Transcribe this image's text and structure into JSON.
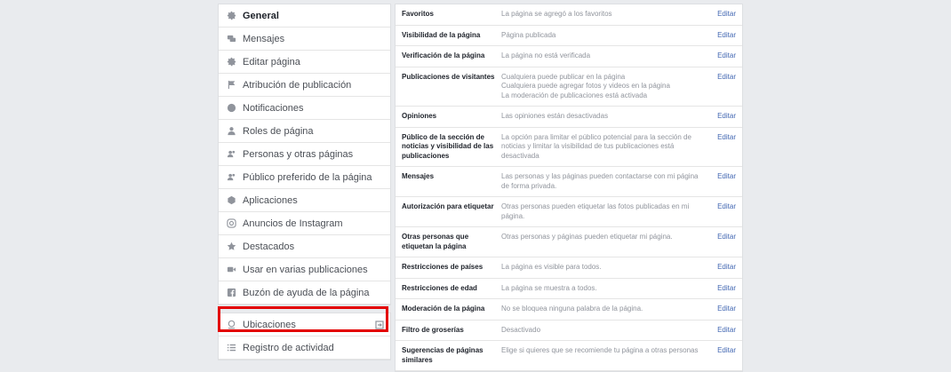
{
  "sidebar": {
    "items": [
      {
        "label": "General",
        "icon": "gear-icon",
        "active": true
      },
      {
        "label": "Mensajes",
        "icon": "messages-icon"
      },
      {
        "label": "Editar página",
        "icon": "gear-icon"
      },
      {
        "label": "Atribución de publicación",
        "icon": "flag-icon"
      },
      {
        "label": "Notificaciones",
        "icon": "globe-icon"
      },
      {
        "label": "Roles de página",
        "icon": "person-icon"
      },
      {
        "label": "Personas y otras páginas",
        "icon": "people-icon"
      },
      {
        "label": "Público preferido de la página",
        "icon": "people-icon"
      },
      {
        "label": "Aplicaciones",
        "icon": "cube-icon"
      },
      {
        "label": "Anuncios de Instagram",
        "icon": "instagram-icon"
      },
      {
        "label": "Destacados",
        "icon": "star-icon"
      },
      {
        "label": "Usar en varias publicaciones",
        "icon": "video-icon"
      },
      {
        "label": "Buzón de ayuda de la página",
        "icon": "facebook-icon"
      }
    ],
    "bottom_items": [
      {
        "label": "Ubicaciones",
        "icon": "location-icon"
      },
      {
        "label": "Registro de actividad",
        "icon": "list-icon"
      }
    ]
  },
  "settings": {
    "edit_label": "Editar",
    "rows": [
      {
        "label": "Favoritos",
        "desc": "La página se agregó a los favoritos"
      },
      {
        "label": "Visibilidad de la página",
        "desc": "Página publicada"
      },
      {
        "label": "Verificación de la página",
        "desc": "La página no está verificada"
      },
      {
        "label": "Publicaciones de visitantes",
        "desc": "Cualquiera puede publicar en la página\nCualquiera puede agregar fotos y videos en la página\nLa moderación de publicaciones está activada"
      },
      {
        "label": "Opiniones",
        "desc": "Las opiniones están desactivadas"
      },
      {
        "label": "Público de la sección de noticias y visibilidad de las publicaciones",
        "desc": "La opción para limitar el público potencial para la sección de noticias y limitar la visibilidad de tus publicaciones está desactivada"
      },
      {
        "label": "Mensajes",
        "desc": "Las personas y las páginas pueden contactarse con mi página de forma privada."
      },
      {
        "label": "Autorización para etiquetar",
        "desc": "Otras personas pueden etiquetar las fotos publicadas en mi página."
      },
      {
        "label": "Otras personas que etiquetan la página",
        "desc": "Otras personas y páginas pueden etiquetar mi página."
      },
      {
        "label": "Restricciones de países",
        "desc": "La página es visible para todos."
      },
      {
        "label": "Restricciones de edad",
        "desc": "La página se muestra a todos."
      },
      {
        "label": "Moderación de la página",
        "desc": "No se bloquea ninguna palabra de la página."
      },
      {
        "label": "Filtro de groserías",
        "desc": "Desactivado"
      },
      {
        "label": "Sugerencias de páginas similares",
        "desc": "Elige si quieres que se recomiende tu página a otras personas"
      }
    ]
  }
}
